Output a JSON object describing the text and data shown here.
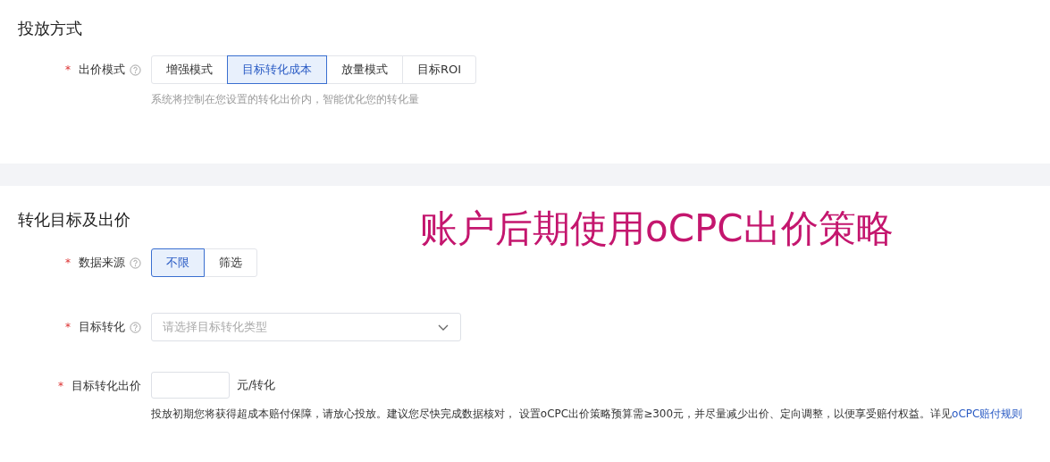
{
  "sections": [
    {
      "title": "投放方式",
      "fields": [
        {
          "kind": "segmented",
          "label": "出价模式",
          "required_mark": "*",
          "help": true,
          "options": [
            {
              "label": "增强模式",
              "selected": false
            },
            {
              "label": "目标转化成本",
              "selected": true
            },
            {
              "label": "放量模式",
              "selected": false
            },
            {
              "label": "目标ROI",
              "selected": false
            }
          ],
          "hint": "系统将控制在您设置的转化出价内，智能优化您的转化量"
        }
      ]
    },
    {
      "title": "转化目标及出价",
      "annotation": "账户后期使用oCPC出价策略",
      "fields": [
        {
          "kind": "segmented",
          "label": "数据来源",
          "required_mark": "*",
          "help": true,
          "options": [
            {
              "label": "不限",
              "selected": true
            },
            {
              "label": "筛选",
              "selected": false
            }
          ]
        },
        {
          "kind": "select",
          "label": "目标转化",
          "required_mark": "*",
          "help": true,
          "placeholder": "请选择目标转化类型"
        },
        {
          "kind": "number",
          "label": "目标转化出价",
          "required_mark": "*",
          "help": false,
          "unit": "元/转化",
          "note": "投放初期您将获得超成本赔付保障，请放心投放。建议您尽快完成数据核对， 设置oCPC出价策略预算需≥300元，并尽量减少出价、定向调整，以便享受赔付权益。详见",
          "link": "oCPC赔付规则"
        }
      ]
    }
  ]
}
